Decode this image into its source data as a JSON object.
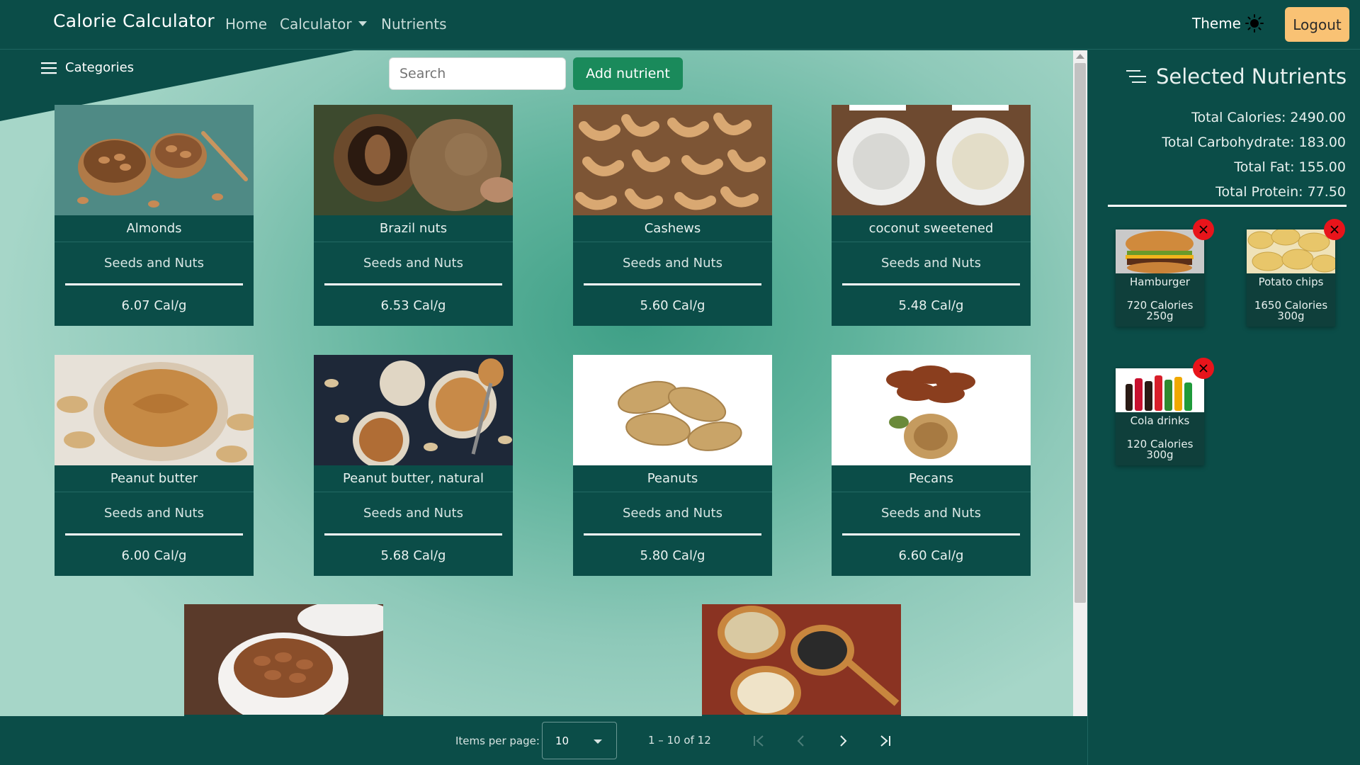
{
  "navbar": {
    "brand": "Calorie Calculator",
    "links": {
      "home": "Home",
      "calculator": "Calculator",
      "nutrients": "Nutrients"
    },
    "theme_label": "Theme",
    "logout_label": "Logout"
  },
  "toolbar": {
    "categories_label": "Categories",
    "search_placeholder": "Search",
    "add_label": "Add nutrient"
  },
  "foods": [
    {
      "name": "Almonds",
      "category": "Seeds and Nuts",
      "calories": "6.07 Cal/g",
      "icon": "almonds-image"
    },
    {
      "name": "Brazil nuts",
      "category": "Seeds and Nuts",
      "calories": "6.53 Cal/g",
      "icon": "brazil-nuts-image"
    },
    {
      "name": "Cashews",
      "category": "Seeds and Nuts",
      "calories": "5.60 Cal/g",
      "icon": "cashews-image"
    },
    {
      "name": "coconut sweetened",
      "category": "Seeds and Nuts",
      "calories": "5.48 Cal/g",
      "icon": "coconut-image"
    },
    {
      "name": "Peanut butter",
      "category": "Seeds and Nuts",
      "calories": "6.00 Cal/g",
      "icon": "peanut-butter-image"
    },
    {
      "name": "Peanut butter, natural",
      "category": "Seeds and Nuts",
      "calories": "5.68 Cal/g",
      "icon": "peanut-butter-natural-image"
    },
    {
      "name": "Peanuts",
      "category": "Seeds and Nuts",
      "calories": "5.80 Cal/g",
      "icon": "peanuts-image"
    },
    {
      "name": "Pecans",
      "category": "Seeds and Nuts",
      "calories": "6.60 Cal/g",
      "icon": "pecans-image"
    }
  ],
  "partial_cards": [
    {
      "icon": "roasted-nuts-image"
    },
    {
      "icon": "seeds-spoons-image"
    }
  ],
  "paginator": {
    "items_per_page_label": "Items per page:",
    "items_per_page": "10",
    "range": "1 – 10 of 12"
  },
  "selected": {
    "title": "Selected Nutrients",
    "totals": {
      "calories": "Total Calories: 2490.00",
      "carbohydrate": "Total Carbohydrate: 183.00",
      "fat": "Total Fat: 155.00",
      "protein": "Total Protein: 77.50"
    },
    "items": [
      {
        "name": "Hamburger",
        "calories": "720 Calories",
        "grams": "250g",
        "icon": "hamburger-image"
      },
      {
        "name": "Potato chips",
        "calories": "1650 Calories",
        "grams": "300g",
        "icon": "potato-chips-image"
      },
      {
        "name": "Cola drinks",
        "calories": "120 Calories",
        "grams": "300g",
        "icon": "cola-image"
      }
    ]
  },
  "colors": {
    "primary": "#0b4d48",
    "accent_button": "#1a8a5b",
    "logout": "#f9c274",
    "remove": "#e8141b"
  }
}
